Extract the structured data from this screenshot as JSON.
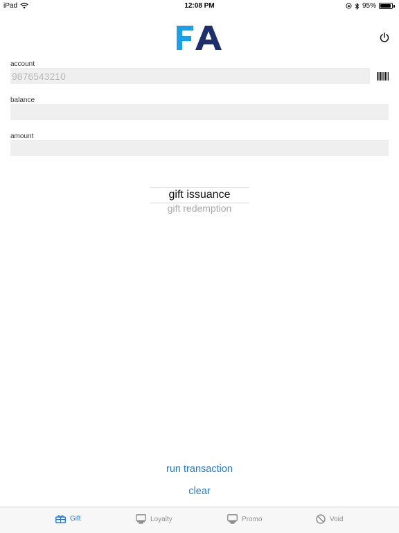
{
  "status_bar": {
    "device": "iPad",
    "time": "12:08 PM",
    "battery": "95%",
    "battery_level": 0.95
  },
  "header": {
    "logo_text": "FA",
    "logo_colors": {
      "f": "#1aa0e8",
      "a": "#1d2e6e"
    }
  },
  "form": {
    "account": {
      "label": "account",
      "value": "",
      "placeholder": "9876543210"
    },
    "balance": {
      "label": "balance",
      "value": ""
    },
    "amount": {
      "label": "amount",
      "value": ""
    }
  },
  "picker": {
    "selected": "gift issuance",
    "next": "gift redemption"
  },
  "actions": {
    "run": "run transaction",
    "clear": "clear"
  },
  "tabs": [
    {
      "label": "Gift",
      "icon": "gift-card-icon",
      "active": true
    },
    {
      "label": "Loyalty",
      "icon": "card-reader-icon",
      "active": false
    },
    {
      "label": "Promo",
      "icon": "card-reader-icon",
      "active": false
    },
    {
      "label": "Void",
      "icon": "void-icon",
      "active": false
    }
  ],
  "colors": {
    "accent": "#1f7ae0",
    "input_bg": "#efefef",
    "tab_inactive": "#8e8e8e"
  }
}
